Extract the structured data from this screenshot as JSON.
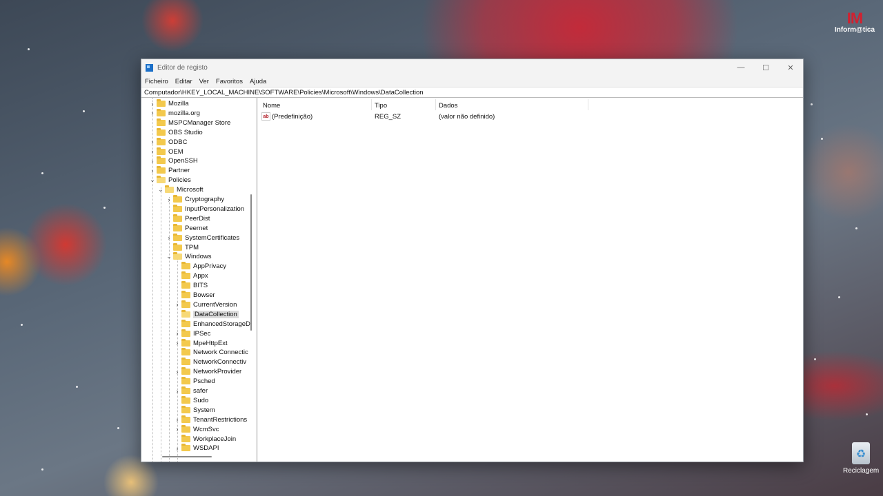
{
  "desktop": {
    "brand_text": "Inform@tica",
    "brand_logo": "IM",
    "recycle_bin_label": "Reciclagem"
  },
  "window": {
    "title": "Editor de registo",
    "controls": {
      "minimize": "—",
      "maximize": "☐",
      "close": "✕"
    },
    "menu": [
      "Ficheiro",
      "Editar",
      "Ver",
      "Favoritos",
      "Ajuda"
    ],
    "address": "Computador\\HKEY_LOCAL_MACHINE\\SOFTWARE\\Policies\\Microsoft\\Windows\\DataCollection"
  },
  "tree": [
    {
      "label": "Mozilla",
      "depth": 0,
      "expander": "›",
      "selected": false
    },
    {
      "label": "mozilla.org",
      "depth": 0,
      "expander": "›",
      "selected": false
    },
    {
      "label": "MSPCManager Store",
      "depth": 0,
      "expander": "",
      "selected": false
    },
    {
      "label": "OBS Studio",
      "depth": 0,
      "expander": "",
      "selected": false
    },
    {
      "label": "ODBC",
      "depth": 0,
      "expander": "›",
      "selected": false
    },
    {
      "label": "OEM",
      "depth": 0,
      "expander": "›",
      "selected": false
    },
    {
      "label": "OpenSSH",
      "depth": 0,
      "expander": "›",
      "selected": false
    },
    {
      "label": "Partner",
      "depth": 0,
      "expander": "›",
      "selected": false
    },
    {
      "label": "Policies",
      "depth": 0,
      "expander": "⌄",
      "selected": false
    },
    {
      "label": "Microsoft",
      "depth": 1,
      "expander": "⌄",
      "selected": false
    },
    {
      "label": "Cryptography",
      "depth": 2,
      "expander": "›",
      "selected": false
    },
    {
      "label": "InputPersonalization",
      "depth": 2,
      "expander": "",
      "selected": false
    },
    {
      "label": "PeerDist",
      "depth": 2,
      "expander": "",
      "selected": false
    },
    {
      "label": "Peernet",
      "depth": 2,
      "expander": "",
      "selected": false
    },
    {
      "label": "SystemCertificates",
      "depth": 2,
      "expander": "›",
      "selected": false
    },
    {
      "label": "TPM",
      "depth": 2,
      "expander": "",
      "selected": false
    },
    {
      "label": "Windows",
      "depth": 2,
      "expander": "⌄",
      "selected": false
    },
    {
      "label": "AppPrivacy",
      "depth": 3,
      "expander": "",
      "selected": false
    },
    {
      "label": "Appx",
      "depth": 3,
      "expander": "",
      "selected": false
    },
    {
      "label": "BITS",
      "depth": 3,
      "expander": "",
      "selected": false
    },
    {
      "label": "Bowser",
      "depth": 3,
      "expander": "",
      "selected": false
    },
    {
      "label": "CurrentVersion",
      "depth": 3,
      "expander": "›",
      "selected": false
    },
    {
      "label": "DataCollection",
      "depth": 3,
      "expander": "",
      "selected": true
    },
    {
      "label": "EnhancedStorageD",
      "depth": 3,
      "expander": "",
      "selected": false
    },
    {
      "label": "IPSec",
      "depth": 3,
      "expander": "›",
      "selected": false
    },
    {
      "label": "MpeHttpExt",
      "depth": 3,
      "expander": "›",
      "selected": false
    },
    {
      "label": "Network Connectic",
      "depth": 3,
      "expander": "",
      "selected": false
    },
    {
      "label": "NetworkConnectiv",
      "depth": 3,
      "expander": "",
      "selected": false
    },
    {
      "label": "NetworkProvider",
      "depth": 3,
      "expander": "›",
      "selected": false
    },
    {
      "label": "Psched",
      "depth": 3,
      "expander": "",
      "selected": false
    },
    {
      "label": "safer",
      "depth": 3,
      "expander": "›",
      "selected": false
    },
    {
      "label": "Sudo",
      "depth": 3,
      "expander": "",
      "selected": false
    },
    {
      "label": "System",
      "depth": 3,
      "expander": "",
      "selected": false
    },
    {
      "label": "TenantRestrictions",
      "depth": 3,
      "expander": "›",
      "selected": false
    },
    {
      "label": "WcmSvc",
      "depth": 3,
      "expander": "›",
      "selected": false
    },
    {
      "label": "WorkplaceJoin",
      "depth": 3,
      "expander": "",
      "selected": false
    },
    {
      "label": "WSDAPI",
      "depth": 3,
      "expander": "›",
      "selected": false
    }
  ],
  "list": {
    "columns": [
      "Nome",
      "Tipo",
      "Dados"
    ],
    "rows": [
      {
        "icon": "ab",
        "name": "(Predefinição)",
        "type": "REG_SZ",
        "data": "(valor não definido)"
      }
    ]
  }
}
